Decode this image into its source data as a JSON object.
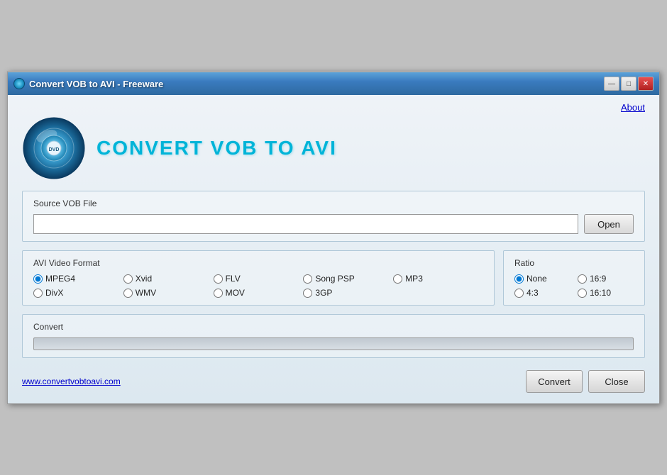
{
  "window": {
    "title": "Convert VOB to AVI - Freeware",
    "icon": "dvd-icon"
  },
  "title_bar_buttons": {
    "minimize": "—",
    "maximize": "□",
    "close": "✕"
  },
  "about_link": "About",
  "app_title": "CONVERT VOB TO AVI",
  "source_section": {
    "label": "Source VOB File",
    "input_placeholder": "",
    "open_button": "Open"
  },
  "format_section": {
    "label": "AVI Video Format",
    "options": [
      {
        "id": "mpeg4",
        "label": "MPEG4",
        "checked": true,
        "row": 0
      },
      {
        "id": "xvid",
        "label": "Xvid",
        "checked": false,
        "row": 0
      },
      {
        "id": "flv",
        "label": "FLV",
        "checked": false,
        "row": 0
      },
      {
        "id": "songpsp",
        "label": "Song PSP",
        "checked": false,
        "row": 0
      },
      {
        "id": "mp3",
        "label": "MP3",
        "checked": false,
        "row": 0
      },
      {
        "id": "divx",
        "label": "DivX",
        "checked": false,
        "row": 1
      },
      {
        "id": "wmv",
        "label": "WMV",
        "checked": false,
        "row": 1
      },
      {
        "id": "mov",
        "label": "MOV",
        "checked": false,
        "row": 1
      },
      {
        "id": "3gp",
        "label": "3GP",
        "checked": false,
        "row": 1
      }
    ]
  },
  "ratio_section": {
    "label": "Ratio",
    "options": [
      {
        "id": "none",
        "label": "None",
        "checked": true
      },
      {
        "id": "16_9",
        "label": "16:9",
        "checked": false
      },
      {
        "id": "4_3",
        "label": "4:3",
        "checked": false
      },
      {
        "id": "16_10",
        "label": "16:10",
        "checked": false
      }
    ]
  },
  "convert_section": {
    "label": "Convert",
    "progress": 0
  },
  "website": "www.convertvobtoavi.com",
  "buttons": {
    "convert": "Convert",
    "close": "Close"
  }
}
